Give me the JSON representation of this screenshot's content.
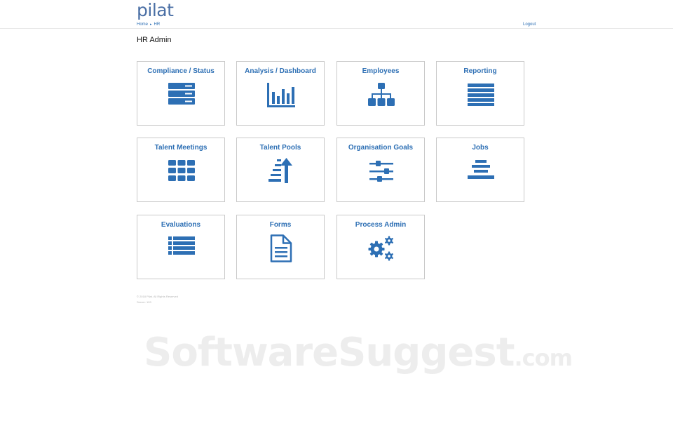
{
  "app": {
    "logo": "pilat"
  },
  "breadcrumb": {
    "home": "Home",
    "separator": "▸",
    "current": "HR"
  },
  "header": {
    "logout": "Logout"
  },
  "page": {
    "title": "HR Admin"
  },
  "tiles": [
    {
      "label": "Compliance / Status",
      "icon": "server-icon"
    },
    {
      "label": "Analysis / Dashboard",
      "icon": "bar-chart-icon"
    },
    {
      "label": "Employees",
      "icon": "org-chart-icon"
    },
    {
      "label": "Reporting",
      "icon": "list-rows-icon"
    },
    {
      "label": "Talent Meetings",
      "icon": "grid-icon"
    },
    {
      "label": "Talent Pools",
      "icon": "sort-ascending-icon"
    },
    {
      "label": "Organisation Goals",
      "icon": "sliders-icon"
    },
    {
      "label": "Jobs",
      "icon": "align-center-icon"
    },
    {
      "label": "Evaluations",
      "icon": "bulleted-list-icon"
    },
    {
      "label": "Forms",
      "icon": "document-icon"
    },
    {
      "label": "Process Admin",
      "icon": "gears-icon"
    }
  ],
  "footer": {
    "copyright": "© 2018 Pilat. All Rights Reserved",
    "server": "Server: 103"
  },
  "watermark": {
    "main": "SoftwareSuggest",
    "suffix": ".com"
  },
  "colors": {
    "accent": "#2d6fb4",
    "logo": "#4a6fa5",
    "tile_border": "#c9c9c9"
  }
}
